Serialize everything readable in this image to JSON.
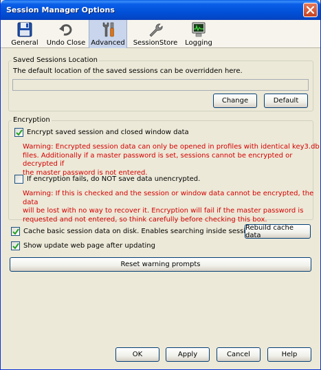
{
  "window": {
    "title": "Session Manager Options"
  },
  "toolbar": {
    "tabs": [
      {
        "label": "General",
        "icon": "floppy-disk-icon"
      },
      {
        "label": "Undo Close",
        "icon": "undo-arrow-icon"
      },
      {
        "label": "Advanced",
        "icon": "tools-icon",
        "active": true
      },
      {
        "label": "SessionStore",
        "icon": "wrench-icon"
      },
      {
        "label": "Logging",
        "icon": "monitor-icon"
      }
    ]
  },
  "saved_sessions": {
    "group_label": "Saved Sessions Location",
    "description": "The default location of the saved sessions can be overridden here.",
    "path_value": "",
    "change_label": "Change",
    "default_label": "Default"
  },
  "encryption": {
    "group_label": "Encryption",
    "encrypt_label": "Encrypt saved session and closed window data",
    "encrypt_checked": true,
    "warning1_lines": [
      "Warning: Encrypted session data can only be opened in profiles with identical key3.db",
      "files. Additionally if a master password is set, sessions cannot be encrypted or decrypted if",
      "the master password is not entered."
    ],
    "no_save_label": "If encryption fails, do NOT save data unencrypted.",
    "no_save_checked": false,
    "warning2_lines": [
      "Warning: If this is checked and the session or window data cannot be encrypted, the data",
      "will be lost with no way to recover it. Encryption will fail if the master password is",
      "requested and not entered, so think carefully before checking this box."
    ]
  },
  "cache": {
    "label": "Cache basic session data on disk. Enables searching inside sessions",
    "checked": true,
    "rebuild_label": "Rebuild cache data"
  },
  "update": {
    "label": "Show update web page after updating",
    "checked": true
  },
  "reset_label": "Reset warning prompts",
  "footer": {
    "ok_label": "OK",
    "apply_label": "Apply",
    "cancel_label": "Cancel",
    "help_label": "Help"
  },
  "colors": {
    "warning_text": "#d40000",
    "titlebar": "#0a5fe8",
    "dialog_bg": "#ece9d8"
  }
}
